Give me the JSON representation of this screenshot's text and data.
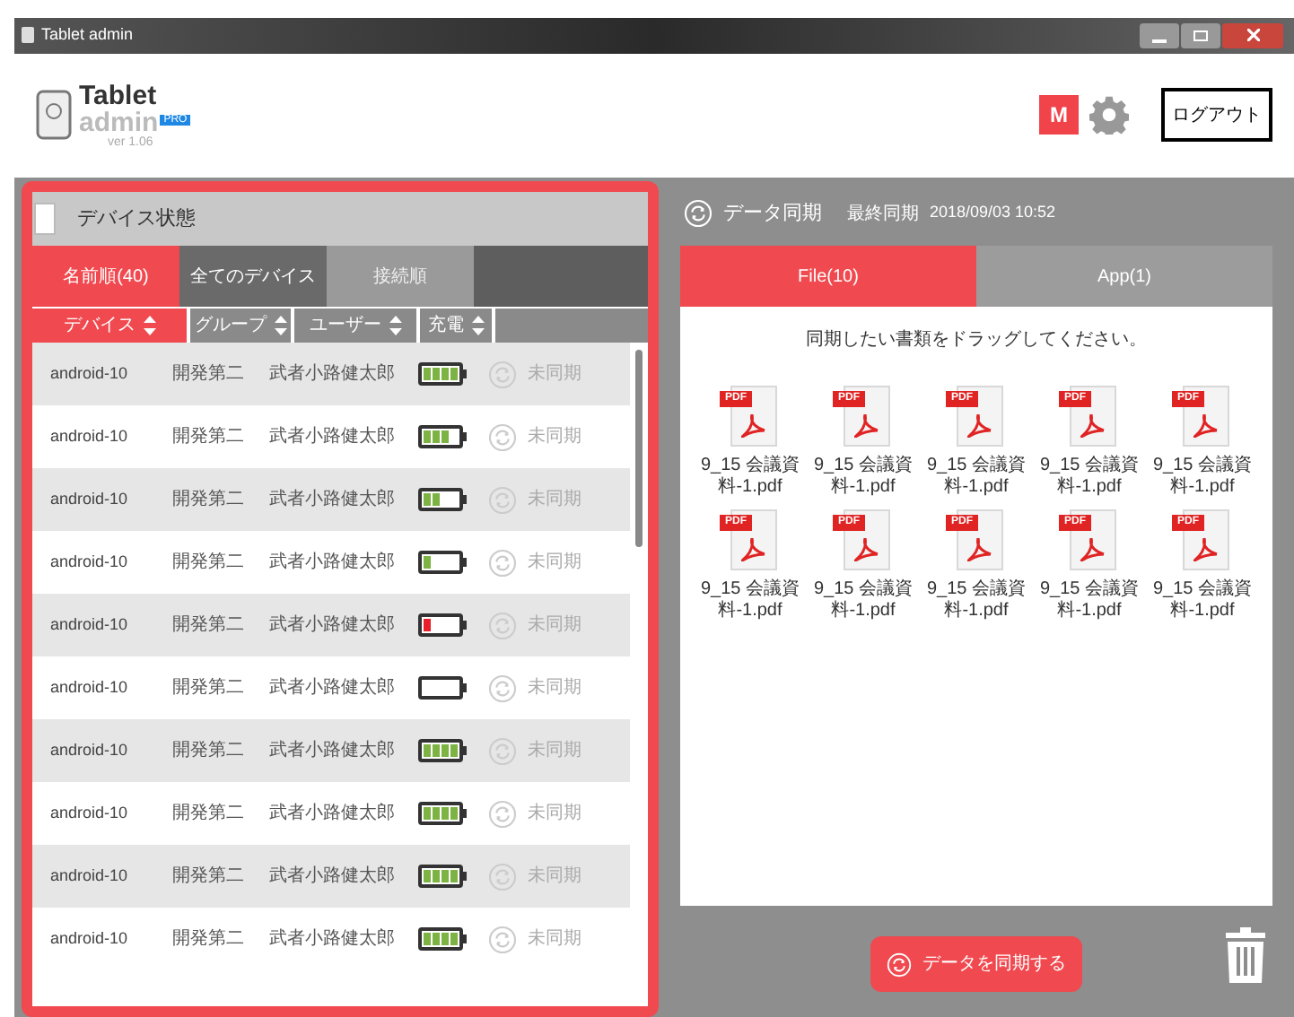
{
  "window": {
    "title": "Tablet admin"
  },
  "header": {
    "logo_title": "Tablet",
    "logo_subtitle": "admin",
    "logo_badge": "PRO",
    "version": "ver 1.06",
    "m_badge": "M",
    "logout": "ログアウト"
  },
  "device_panel": {
    "title": "デバイス状態",
    "select_all_checked": false,
    "tabs": [
      {
        "label": "名前順(40)",
        "selected": true
      },
      {
        "label": "全てのデバイス",
        "selected": false
      },
      {
        "label": "接続順",
        "selected": false
      }
    ],
    "columns": [
      {
        "label": "デバイス",
        "selected": true
      },
      {
        "label": "グループ",
        "selected": false
      },
      {
        "label": "ユーザー",
        "selected": false
      },
      {
        "label": "充電",
        "selected": false
      }
    ],
    "rows": [
      {
        "device": "android-10",
        "group": "開発第二",
        "user": "武者小路健太郎",
        "battery": {
          "kind": "full",
          "color": "#7cb342"
        },
        "sync": "未同期"
      },
      {
        "device": "android-10",
        "group": "開発第二",
        "user": "武者小路健太郎",
        "battery": {
          "kind": "high",
          "color": "#7cb342"
        },
        "sync": "未同期"
      },
      {
        "device": "android-10",
        "group": "開発第二",
        "user": "武者小路健太郎",
        "battery": {
          "kind": "half",
          "color": "#7cb342"
        },
        "sync": "未同期"
      },
      {
        "device": "android-10",
        "group": "開発第二",
        "user": "武者小路健太郎",
        "battery": {
          "kind": "low",
          "color": "#7cb342"
        },
        "sync": "未同期"
      },
      {
        "device": "android-10",
        "group": "開発第二",
        "user": "武者小路健太郎",
        "battery": {
          "kind": "low",
          "color": "#e8202a"
        },
        "sync": "未同期"
      },
      {
        "device": "android-10",
        "group": "開発第二",
        "user": "武者小路健太郎",
        "battery": {
          "kind": "empty"
        },
        "sync": "未同期"
      },
      {
        "device": "android-10",
        "group": "開発第二",
        "user": "武者小路健太郎",
        "battery": {
          "kind": "full",
          "color": "#7cb342"
        },
        "sync": "未同期"
      },
      {
        "device": "android-10",
        "group": "開発第二",
        "user": "武者小路健太郎",
        "battery": {
          "kind": "full",
          "color": "#7cb342"
        },
        "sync": "未同期"
      },
      {
        "device": "android-10",
        "group": "開発第二",
        "user": "武者小路健太郎",
        "battery": {
          "kind": "full",
          "color": "#7cb342"
        },
        "sync": "未同期"
      },
      {
        "device": "android-10",
        "group": "開発第二",
        "user": "武者小路健太郎",
        "battery": {
          "kind": "full",
          "color": "#7cb342"
        },
        "sync": "未同期"
      }
    ]
  },
  "sync_panel": {
    "title": "データ同期",
    "last_sync_label": "最終同期",
    "last_sync": "2018/09/03 10:52",
    "tabs": [
      {
        "label": "File(10)",
        "selected": true
      },
      {
        "label": "App(1)",
        "selected": false
      }
    ],
    "instruction": "同期したい書類をドラッグしてください。",
    "files": [
      {
        "icon_label": "PDF",
        "name": "9_15 会議資料-1.pdf"
      },
      {
        "icon_label": "PDF",
        "name": "9_15 会議資料-1.pdf"
      },
      {
        "icon_label": "PDF",
        "name": "9_15 会議資料-1.pdf"
      },
      {
        "icon_label": "PDF",
        "name": "9_15 会議資料-1.pdf"
      },
      {
        "icon_label": "PDF",
        "name": "9_15 会議資料-1.pdf"
      },
      {
        "icon_label": "PDF",
        "name": "9_15 会議資料-1.pdf"
      },
      {
        "icon_label": "PDF",
        "name": "9_15 会議資料-1.pdf"
      },
      {
        "icon_label": "PDF",
        "name": "9_15 会議資料-1.pdf"
      },
      {
        "icon_label": "PDF",
        "name": "9_15 会議資料-1.pdf"
      },
      {
        "icon_label": "PDF",
        "name": "9_15 会議資料-1.pdf"
      }
    ],
    "sync_button": "データを同期する"
  }
}
